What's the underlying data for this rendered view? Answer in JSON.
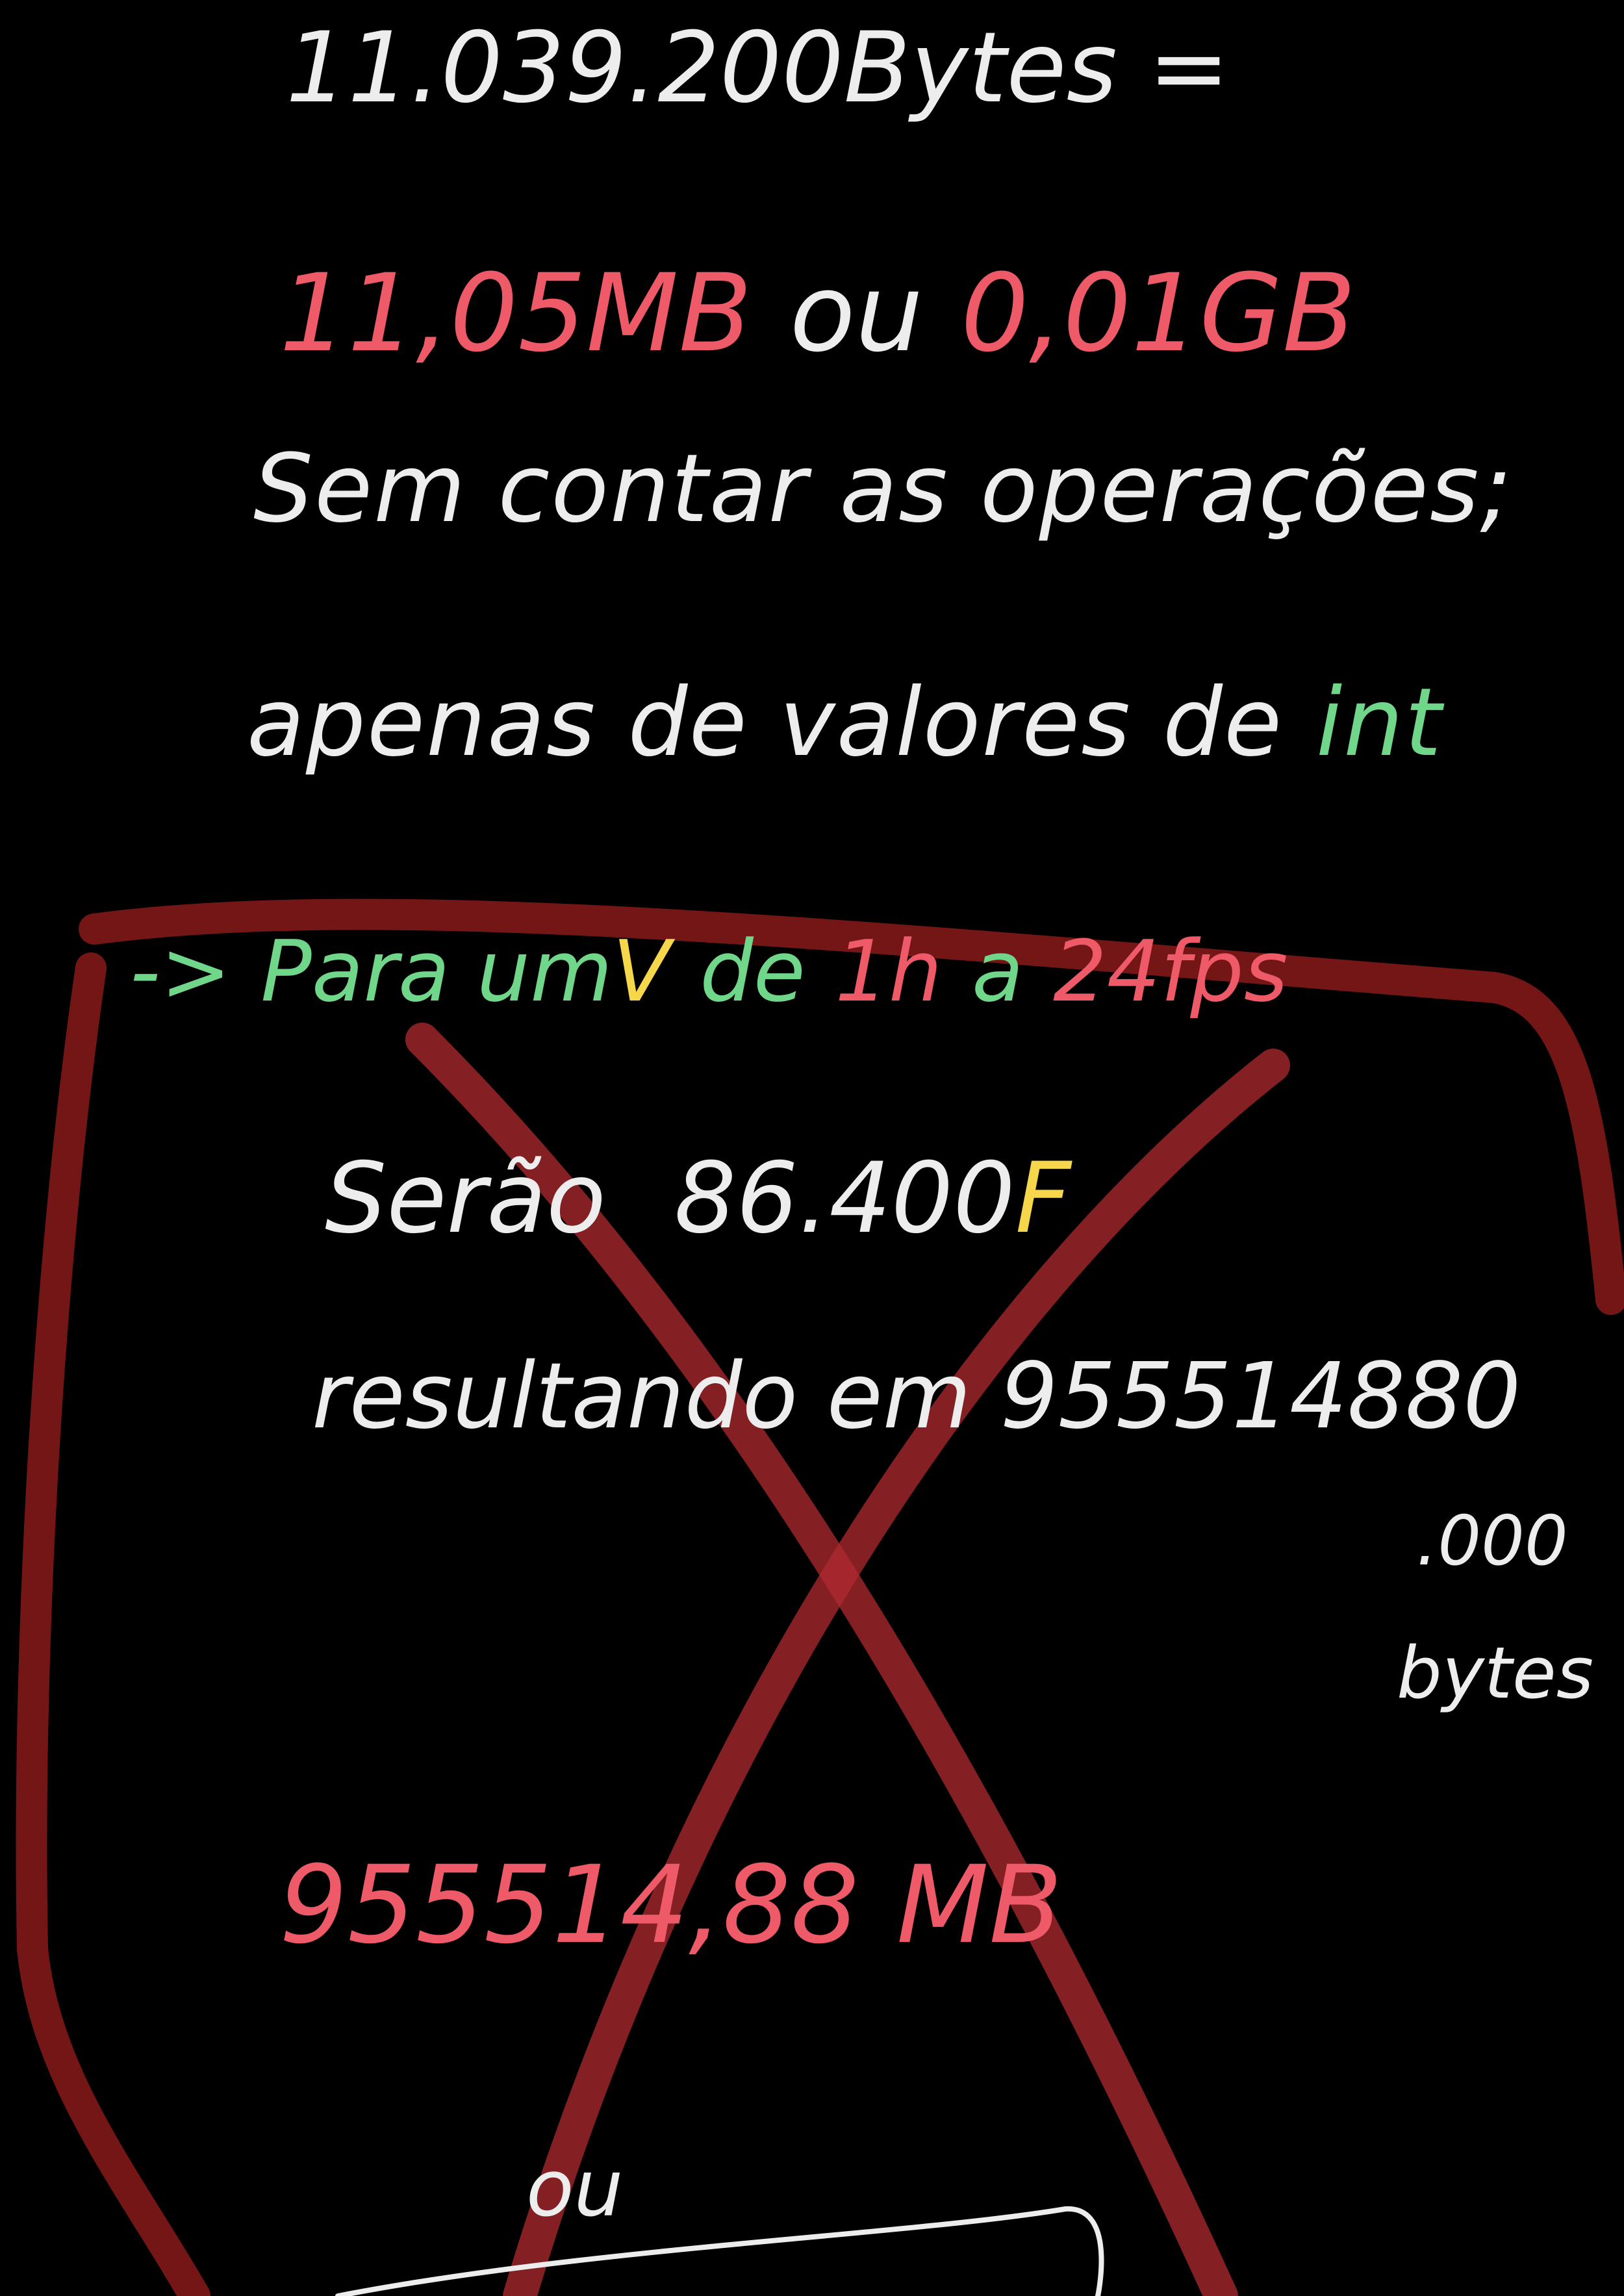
{
  "note_lines": {
    "l1": "11.039.200Bytes =",
    "l2_a": "11,05MB",
    "l2_b": "ou",
    "l2_c": "0,01GB",
    "l3": "Sem contar as operações;",
    "l4_a": "apenas de valores de",
    "l4_b": "int",
    "l5_arrow": "->",
    "l5_a": "Para um",
    "l5_v": "V",
    "l5_b": "de",
    "l5_c": "1h",
    "l5_d": "a",
    "l5_e": "24fps",
    "l6_a": "Serão",
    "l6_b": "86.400",
    "l6_c": "F",
    "l7": "resultando em 955514880",
    "l8": ".000",
    "l9": "bytes",
    "l10_a": "955514,88",
    "l10_b": "MB",
    "l11": "ou"
  },
  "colors": {
    "background": "#000000",
    "white_ink": "#ededed",
    "red_ink": "#ee5a68",
    "green_ink": "#6fd68a",
    "yellow_ink": "#f6d64a",
    "strike_marker": "#8b1a1a",
    "outline_marker": "#7a1717"
  }
}
